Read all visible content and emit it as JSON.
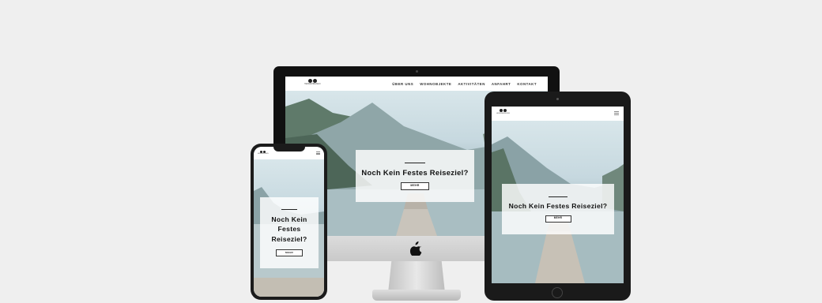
{
  "site": {
    "logo_text": "HEIMWEHREISEN",
    "nav": [
      "ÜBER UNS",
      "WOHNOBJEKTE",
      "AKTIVITÄTEN",
      "ANFAHRT",
      "KONTAKT"
    ],
    "hero_title": "Noch Kein Festes Reiseziel?",
    "hero_title_phone": "Noch Kein Festes Reiseziel?",
    "hero_button": "MEHR"
  },
  "colors": {
    "background": "#efefef",
    "device_frame": "#111111",
    "hero_card": "#ffffff"
  },
  "icons": [
    "apple-logo-icon",
    "hamburger-menu-icon"
  ]
}
